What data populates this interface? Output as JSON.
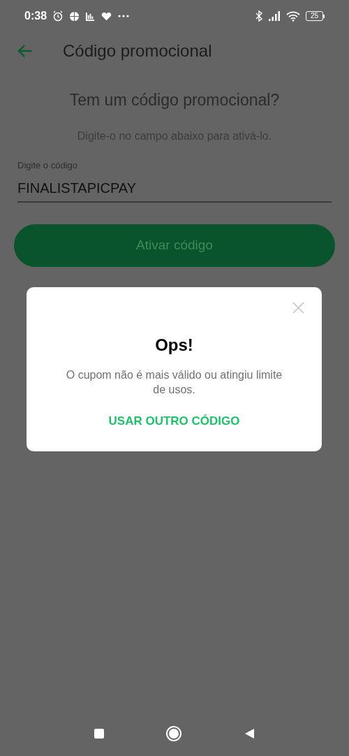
{
  "status_bar": {
    "time": "0:38",
    "battery": "25"
  },
  "header": {
    "title": "Código promocional"
  },
  "content": {
    "heading": "Tem um código promocional?",
    "subtitle": "Digite-o no campo abaixo para ativá-lo.",
    "field": {
      "label": "Digite o código",
      "value": "FINALISTAPICPAY"
    },
    "button": "Ativar código"
  },
  "dialog": {
    "title": "Ops!",
    "message": "O cupom não é mais válido ou atingiu limite de usos.",
    "action": "USAR OUTRO CÓDIGO"
  }
}
